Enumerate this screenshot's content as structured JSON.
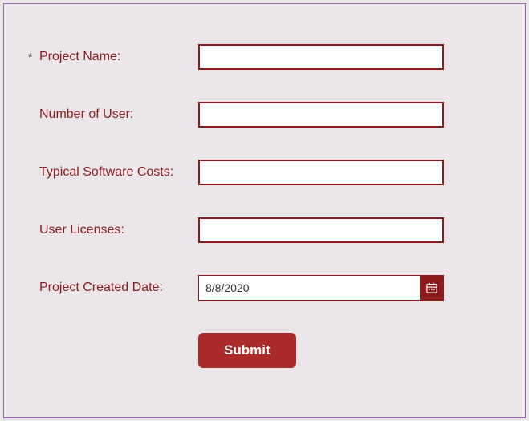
{
  "form": {
    "required_marker": "*",
    "project_name": {
      "label": "Project Name:",
      "value": ""
    },
    "number_of_user": {
      "label": "Number of User:",
      "value": ""
    },
    "software_costs": {
      "label": "Typical Software Costs:",
      "value": ""
    },
    "user_licenses": {
      "label": "User Licenses:",
      "value": ""
    },
    "created_date": {
      "label": "Project Created Date:",
      "value": "8/8/2020"
    },
    "submit_label": "Submit"
  }
}
